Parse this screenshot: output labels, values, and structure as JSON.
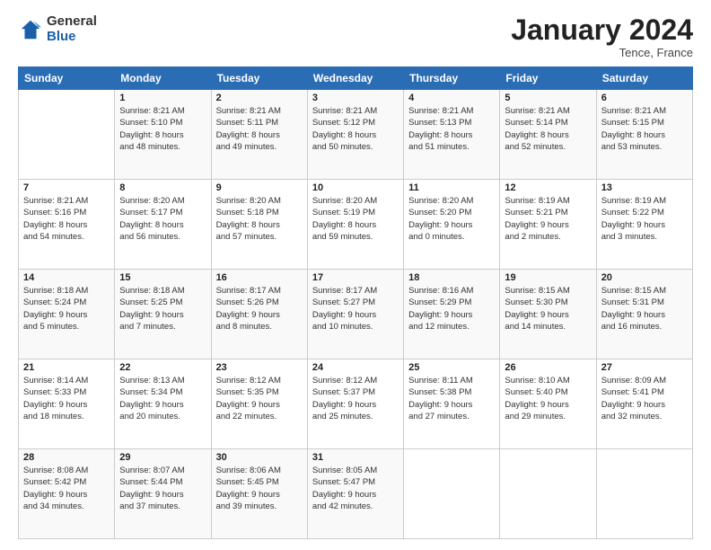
{
  "header": {
    "logo": {
      "general": "General",
      "blue": "Blue"
    },
    "month": "January 2024",
    "location": "Tence, France"
  },
  "days_of_week": [
    "Sunday",
    "Monday",
    "Tuesday",
    "Wednesday",
    "Thursday",
    "Friday",
    "Saturday"
  ],
  "weeks": [
    [
      {
        "day": "",
        "detail": ""
      },
      {
        "day": "1",
        "detail": "Sunrise: 8:21 AM\nSunset: 5:10 PM\nDaylight: 8 hours\nand 48 minutes."
      },
      {
        "day": "2",
        "detail": "Sunrise: 8:21 AM\nSunset: 5:11 PM\nDaylight: 8 hours\nand 49 minutes."
      },
      {
        "day": "3",
        "detail": "Sunrise: 8:21 AM\nSunset: 5:12 PM\nDaylight: 8 hours\nand 50 minutes."
      },
      {
        "day": "4",
        "detail": "Sunrise: 8:21 AM\nSunset: 5:13 PM\nDaylight: 8 hours\nand 51 minutes."
      },
      {
        "day": "5",
        "detail": "Sunrise: 8:21 AM\nSunset: 5:14 PM\nDaylight: 8 hours\nand 52 minutes."
      },
      {
        "day": "6",
        "detail": "Sunrise: 8:21 AM\nSunset: 5:15 PM\nDaylight: 8 hours\nand 53 minutes."
      }
    ],
    [
      {
        "day": "7",
        "detail": "Sunrise: 8:21 AM\nSunset: 5:16 PM\nDaylight: 8 hours\nand 54 minutes."
      },
      {
        "day": "8",
        "detail": "Sunrise: 8:20 AM\nSunset: 5:17 PM\nDaylight: 8 hours\nand 56 minutes."
      },
      {
        "day": "9",
        "detail": "Sunrise: 8:20 AM\nSunset: 5:18 PM\nDaylight: 8 hours\nand 57 minutes."
      },
      {
        "day": "10",
        "detail": "Sunrise: 8:20 AM\nSunset: 5:19 PM\nDaylight: 8 hours\nand 59 minutes."
      },
      {
        "day": "11",
        "detail": "Sunrise: 8:20 AM\nSunset: 5:20 PM\nDaylight: 9 hours\nand 0 minutes."
      },
      {
        "day": "12",
        "detail": "Sunrise: 8:19 AM\nSunset: 5:21 PM\nDaylight: 9 hours\nand 2 minutes."
      },
      {
        "day": "13",
        "detail": "Sunrise: 8:19 AM\nSunset: 5:22 PM\nDaylight: 9 hours\nand 3 minutes."
      }
    ],
    [
      {
        "day": "14",
        "detail": "Sunrise: 8:18 AM\nSunset: 5:24 PM\nDaylight: 9 hours\nand 5 minutes."
      },
      {
        "day": "15",
        "detail": "Sunrise: 8:18 AM\nSunset: 5:25 PM\nDaylight: 9 hours\nand 7 minutes."
      },
      {
        "day": "16",
        "detail": "Sunrise: 8:17 AM\nSunset: 5:26 PM\nDaylight: 9 hours\nand 8 minutes."
      },
      {
        "day": "17",
        "detail": "Sunrise: 8:17 AM\nSunset: 5:27 PM\nDaylight: 9 hours\nand 10 minutes."
      },
      {
        "day": "18",
        "detail": "Sunrise: 8:16 AM\nSunset: 5:29 PM\nDaylight: 9 hours\nand 12 minutes."
      },
      {
        "day": "19",
        "detail": "Sunrise: 8:15 AM\nSunset: 5:30 PM\nDaylight: 9 hours\nand 14 minutes."
      },
      {
        "day": "20",
        "detail": "Sunrise: 8:15 AM\nSunset: 5:31 PM\nDaylight: 9 hours\nand 16 minutes."
      }
    ],
    [
      {
        "day": "21",
        "detail": "Sunrise: 8:14 AM\nSunset: 5:33 PM\nDaylight: 9 hours\nand 18 minutes."
      },
      {
        "day": "22",
        "detail": "Sunrise: 8:13 AM\nSunset: 5:34 PM\nDaylight: 9 hours\nand 20 minutes."
      },
      {
        "day": "23",
        "detail": "Sunrise: 8:12 AM\nSunset: 5:35 PM\nDaylight: 9 hours\nand 22 minutes."
      },
      {
        "day": "24",
        "detail": "Sunrise: 8:12 AM\nSunset: 5:37 PM\nDaylight: 9 hours\nand 25 minutes."
      },
      {
        "day": "25",
        "detail": "Sunrise: 8:11 AM\nSunset: 5:38 PM\nDaylight: 9 hours\nand 27 minutes."
      },
      {
        "day": "26",
        "detail": "Sunrise: 8:10 AM\nSunset: 5:40 PM\nDaylight: 9 hours\nand 29 minutes."
      },
      {
        "day": "27",
        "detail": "Sunrise: 8:09 AM\nSunset: 5:41 PM\nDaylight: 9 hours\nand 32 minutes."
      }
    ],
    [
      {
        "day": "28",
        "detail": "Sunrise: 8:08 AM\nSunset: 5:42 PM\nDaylight: 9 hours\nand 34 minutes."
      },
      {
        "day": "29",
        "detail": "Sunrise: 8:07 AM\nSunset: 5:44 PM\nDaylight: 9 hours\nand 37 minutes."
      },
      {
        "day": "30",
        "detail": "Sunrise: 8:06 AM\nSunset: 5:45 PM\nDaylight: 9 hours\nand 39 minutes."
      },
      {
        "day": "31",
        "detail": "Sunrise: 8:05 AM\nSunset: 5:47 PM\nDaylight: 9 hours\nand 42 minutes."
      },
      {
        "day": "",
        "detail": ""
      },
      {
        "day": "",
        "detail": ""
      },
      {
        "day": "",
        "detail": ""
      }
    ]
  ]
}
